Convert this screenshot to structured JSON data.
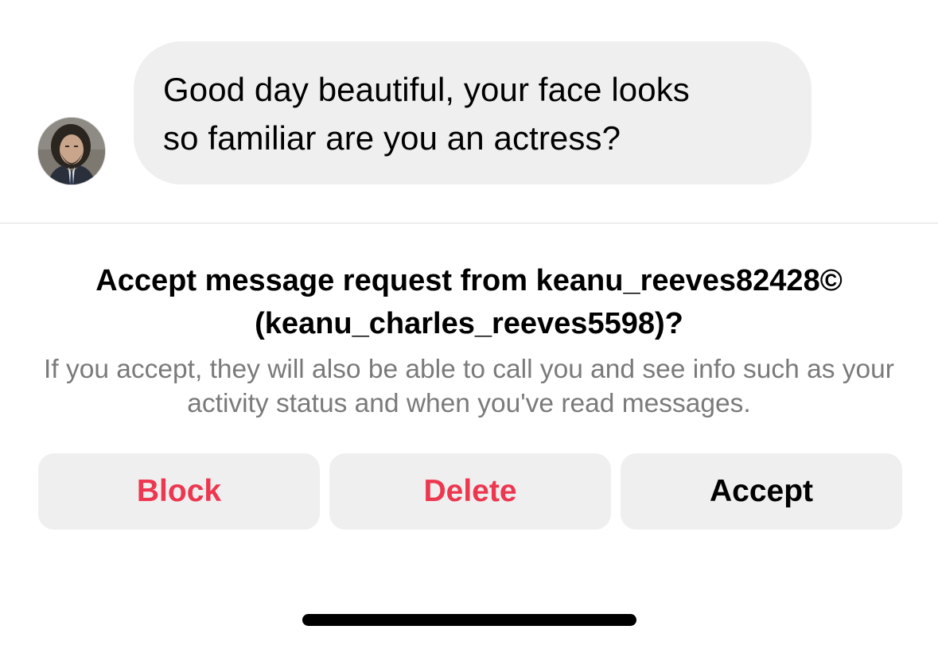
{
  "conversation": {
    "sender_avatar": "profile-photo-avatar",
    "message_text": "Good day beautiful, your face looks\nso familiar are you an actress?"
  },
  "request": {
    "title": "Accept message request from keanu_reeves82428© (keanu_charles_reeves5598)?",
    "body": "If you accept, they will also be able to call you and see info such as your activity status and when you've read messages."
  },
  "actions": {
    "block_label": "Block",
    "delete_label": "Delete",
    "accept_label": "Accept"
  },
  "colors": {
    "danger": "#ed3750",
    "bubble_background": "#efefef",
    "secondary_text": "#7a7a7a"
  }
}
